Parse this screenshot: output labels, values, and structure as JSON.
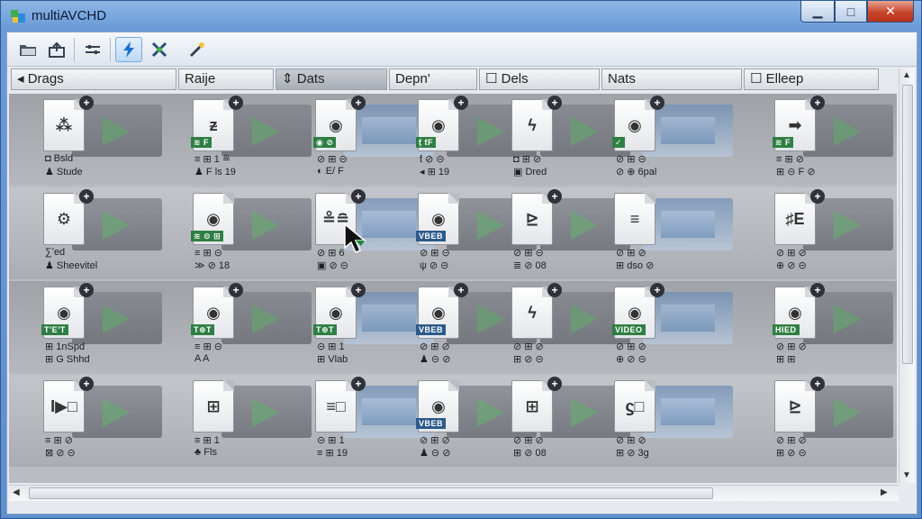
{
  "window": {
    "title": "multiAVCHD",
    "minimize_glyph": "▁",
    "maximize_glyph": "□",
    "close_glyph": "✕",
    "accent": "#3f74b5"
  },
  "toolbar": {
    "buttons": [
      {
        "icon": "folder-icon"
      },
      {
        "icon": "open-icon"
      },
      {
        "icon": "list-icon"
      },
      {
        "icon": "lightning-icon"
      },
      {
        "icon": "tools-icon"
      },
      {
        "icon": "wand-icon"
      }
    ]
  },
  "columns": [
    {
      "label": "◂ Drags"
    },
    {
      "label": "Raije"
    },
    {
      "label": "⇕ Dats"
    },
    {
      "label": "Depn'"
    },
    {
      "label": "☐ Dels"
    },
    {
      "label": "Nats"
    },
    {
      "label": "☐ Elleep"
    }
  ],
  "rows": [
    {
      "cells": [
        {
          "glyph": "⁂",
          "tag": "",
          "l1": "◘ Bsld",
          "l2": "♟ Stude"
        },
        {
          "glyph": "ᵶ",
          "tag": "≋ F",
          "l1": "≡ ⊞ 1 ≞",
          "l2": "♟ F ls 19"
        },
        {
          "glyph": "◉",
          "tag": "◉ ⊘",
          "l1": "⊘ ⊞ ⊝",
          "l2": "◐ E/ F"
        },
        {
          "glyph": "◉",
          "tag": "ƭ̣ ƭF",
          "l1": "ƭ ⊘ ⊝",
          "l2": "◂ ⊞ 19"
        },
        {
          "glyph": "ϟ",
          "tag": "",
          "l1": "◘ ⊞ ⊘",
          "l2": "▣ Dred"
        },
        {
          "glyph": "◉",
          "tag": "✓",
          "l1": "⊘ ⊞ ⊝",
          "l2": "⊘ ⊕ 6pal"
        },
        {
          "glyph": "➡",
          "tag": "≋ F",
          "l1": "≡ ⊞ ⊘",
          "l2": "⊞ ⊝ F ⊘"
        }
      ]
    },
    {
      "cells": [
        {
          "glyph": "⚙",
          "tag": "",
          "l1": "∑ʹed",
          "l2": "♟ Sheevitel"
        },
        {
          "glyph": "◉",
          "tag": "≋ ⊝ ⊞",
          "l1": "≡ ⊞ ⊝",
          "l2": "≫ ⊘ 18"
        },
        {
          "glyph": "≗≘",
          "tag": "",
          "l1": "⊘ ⊞ 6",
          "l2": "▣ ⊘ ⊝"
        },
        {
          "glyph": "◉",
          "tag": "VBEB",
          "l1": "⊘ ⊞ ⊝",
          "l2": "ψ ⊘ ⊝"
        },
        {
          "glyph": "⊵",
          "tag": "",
          "l1": "⊘ ⊞ ⊝",
          "l2": "≣ ⊘ 08"
        },
        {
          "glyph": "≡",
          "tag": "",
          "l1": "⊘ ⊞ ⊘",
          "l2": "⊞ dso ⊘"
        },
        {
          "glyph": "♯E",
          "tag": "",
          "l1": "⊘ ⊞ ⊘",
          "l2": "⊕ ⊘ ⊝"
        }
      ]
    },
    {
      "cells": [
        {
          "glyph": "◉",
          "tag": "T'E'T",
          "l1": "⊞ 1nSpd",
          "l2": "⊞ G Shhd"
        },
        {
          "glyph": "◉",
          "tag": "T⊕T",
          "l1": "≡ ⊞ ⊝",
          "l2": "A A"
        },
        {
          "glyph": "◉",
          "tag": "T⊕T",
          "l1": "⊝ ⊞ 1",
          "l2": "⊞ Vlab"
        },
        {
          "glyph": "◉",
          "tag": "VBEB",
          "l1": "⊘ ⊞ ⊘",
          "l2": "♟ ⊝ ⊘"
        },
        {
          "glyph": "ϟ",
          "tag": "",
          "l1": "⊘ ⊞ ⊘",
          "l2": "⊞ ⊘ ⊝"
        },
        {
          "glyph": "◉",
          "tag": "VIDEO",
          "l1": "⊘ ⊞ ⊘",
          "l2": "⊕ ⊘ ⊝"
        },
        {
          "glyph": "◉",
          "tag": "HIED",
          "l1": "⊘ ⊞ ⊘",
          "l2": "⊞ ⊞"
        }
      ]
    },
    {
      "cells": [
        {
          "glyph": "I▶□",
          "tag": "",
          "l1": "≡ ⊞ ⊘",
          "l2": "⊠ ⊘ ⊝"
        },
        {
          "glyph": "⊞",
          "tag": "",
          "l1": "≡ ⊞ 1",
          "l2": "♣ Fls"
        },
        {
          "glyph": "≡□",
          "tag": "",
          "l1": "⊝ ⊞ 1",
          "l2": "≡ ⊞ 19"
        },
        {
          "glyph": "◉",
          "tag": "VBEB",
          "l1": "⊘ ⊞ ⊘",
          "l2": "♟ ⊝ ⊘"
        },
        {
          "glyph": "⊞",
          "tag": "",
          "l1": "⊘ ⊞ ⊘",
          "l2": "⊞ ⊘ 08"
        },
        {
          "glyph": "ϛ□",
          "tag": "",
          "l1": "⊘ ⊞ ⊘",
          "l2": "⊞ ⊘ 3g"
        },
        {
          "glyph": "⊵",
          "tag": "",
          "l1": "⊘ ⊞ ⊘",
          "l2": "⊞ ⊘ ⊝"
        }
      ]
    }
  ]
}
